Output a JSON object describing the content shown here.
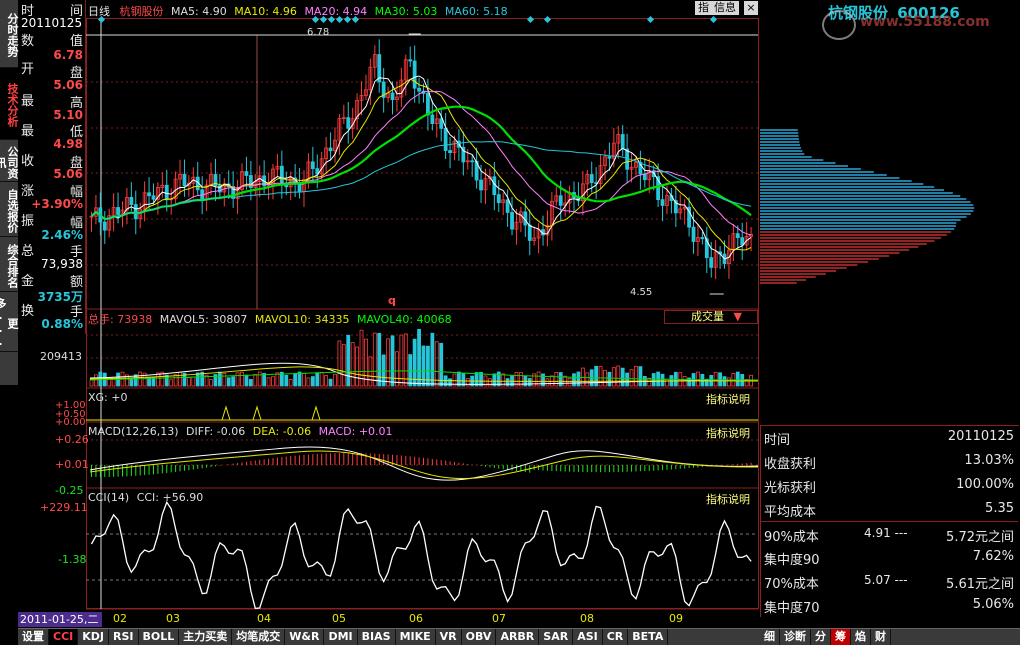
{
  "window": {
    "buttons": {
      "pin": "指",
      "info": "信息",
      "close": "×"
    }
  },
  "left_tabs": [
    {
      "label": "分时走势",
      "active": false
    },
    {
      "label": "技术分析",
      "active": true
    },
    {
      "label": "公司资讯",
      "active": false
    },
    {
      "label": "自选报价",
      "active": false
    },
    {
      "label": "综合排名",
      "active": false
    },
    {
      "label": "更多...",
      "active": false
    }
  ],
  "info_panel": {
    "time_label": "时",
    "time_label2": "间",
    "date": "20110125",
    "value_label": "数",
    "value_label2": "值",
    "open_label": "开",
    "open_label2": "盘",
    "open": "6.78",
    "high_label": "最",
    "high_label2": "高",
    "high": "5.06",
    "low_label": "最",
    "low_label2": "低",
    "low": "5.10",
    "close_label": "收",
    "close_label2": "盘",
    "close": "4.98",
    "change_label": "涨",
    "change_label2": "幅",
    "change_price": "5.06",
    "change_pct": "+3.90%",
    "amp_label": "振",
    "amp_label2": "幅",
    "amp": "2.46%",
    "vol_label": "总",
    "vol_label2": "手",
    "vol": "73,938",
    "amt_label": "金",
    "amt_label2": "额",
    "amt": "3735万",
    "turn_label": "换",
    "turn_label2": "手",
    "turn": "0.88%"
  },
  "main_chart": {
    "period": "日线",
    "stock_name": "杭钢股份",
    "ma": [
      {
        "label": "MA5: 4.90",
        "color": "#ffffff"
      },
      {
        "label": "MA10: 4.96",
        "color": "#e8e800"
      },
      {
        "label": "MA20: 4.94",
        "color": "#ff80ff"
      },
      {
        "label": "MA30: 5.03",
        "color": "#00ff00"
      },
      {
        "label": "MA60: 5.18",
        "color": "#26c6da"
      }
    ],
    "high_marker": "6.78",
    "low_marker": "4.55",
    "q_marker": "q"
  },
  "volume_panel": {
    "header_label": "总手:",
    "header_value": "73938",
    "mavol": [
      {
        "label": "MAVOL5: 30807",
        "color": "#ffffff"
      },
      {
        "label": "MAVOL10: 34335",
        "color": "#e8e800"
      },
      {
        "label": "MAVOL40: 40068",
        "color": "#00ff00"
      }
    ],
    "dropdown": "成交量",
    "y_tick": "209413"
  },
  "xg_panel": {
    "label": "XG: +0",
    "explain": "指标说明",
    "ticks": [
      "+1.00",
      "+0.50",
      "+0.00"
    ]
  },
  "macd_panel": {
    "label": "MACD(12,26,13)",
    "diff": "DIFF: -0.06",
    "dea": "DEA: -0.06",
    "macd": "MACD: +0.01",
    "explain": "指标说明",
    "ticks": [
      "+0.26",
      "+0.01",
      "-0.25"
    ]
  },
  "cci_panel": {
    "label": "CCI(14)",
    "cci": "CCI: +56.90",
    "explain": "指标说明",
    "ticks": [
      "+229.11",
      "-1.38"
    ]
  },
  "x_axis": {
    "cursor_date": "2011-01-25,二",
    "months": [
      "02",
      "03",
      "04",
      "05",
      "06",
      "07",
      "08",
      "09"
    ]
  },
  "bottom_tabs": [
    {
      "label": "设置",
      "active": false
    },
    {
      "label": "CCI",
      "active": true
    },
    {
      "label": "KDJ",
      "active": false
    },
    {
      "label": "RSI",
      "active": false
    },
    {
      "label": "BOLL",
      "active": false
    },
    {
      "label": "主力买卖",
      "active": false
    },
    {
      "label": "均笔成交",
      "active": false
    },
    {
      "label": "W&R",
      "active": false
    },
    {
      "label": "DMI",
      "active": false
    },
    {
      "label": "BIAS",
      "active": false
    },
    {
      "label": "MIKE",
      "active": false
    },
    {
      "label": "VR",
      "active": false
    },
    {
      "label": "OBV",
      "active": false
    },
    {
      "label": "ARBR",
      "active": false
    },
    {
      "label": "SAR",
      "active": false
    },
    {
      "label": "ASI",
      "active": false
    },
    {
      "label": "CR",
      "active": false
    },
    {
      "label": "BETA",
      "active": false
    }
  ],
  "right_panel": {
    "title": "杭钢股份",
    "code": "600126",
    "watermark": "www.55188.com",
    "stats": [
      {
        "label": "时间",
        "mid": "",
        "value": "20110125"
      },
      {
        "label": "收盘获利",
        "mid": "",
        "value": "13.03%"
      },
      {
        "label": "光标获利",
        "mid": "",
        "value": "100.00%"
      },
      {
        "label": "平均成本",
        "mid": "",
        "value": "5.35"
      },
      {
        "label": "90%成本",
        "mid": "4.91 ---",
        "value": "5.72元之间"
      },
      {
        "label": "集中度90",
        "mid": "",
        "value": "7.62%"
      },
      {
        "label": "70%成本",
        "mid": "5.07 ---",
        "value": "5.61元之间"
      },
      {
        "label": "集中度70",
        "mid": "",
        "value": "5.06%"
      }
    ],
    "bottom_tabs": [
      {
        "label": "细",
        "active": false
      },
      {
        "label": "诊断",
        "active": false
      },
      {
        "label": "分",
        "active": false
      },
      {
        "label": "筹",
        "active": true
      },
      {
        "label": "焰",
        "active": false
      },
      {
        "label": "财",
        "active": false
      }
    ]
  },
  "colors": {
    "up": "#ff3b3b",
    "down": "#26c6da",
    "grid": "#7a1f1f",
    "frame": "#8a2020"
  }
}
